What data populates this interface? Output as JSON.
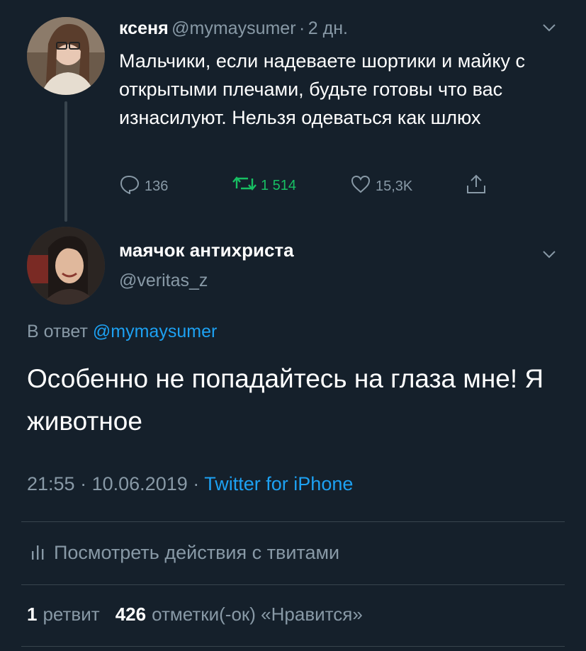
{
  "tweet1": {
    "name": "ксеня",
    "handle": "@mymaysumer",
    "separator": "·",
    "time": "2 дн.",
    "text": "Мальчики, если надеваете шортики и майку с открытыми плечами, будьте готовы что вас изнасилуют. Нельзя одеваться как шлюх",
    "replies": "136",
    "retweets": "1 514",
    "likes": "15,3K"
  },
  "tweet2": {
    "name": "маячок антихриста",
    "handle": "@veritas_z",
    "reply_prefix": "В ответ",
    "reply_to": "@mymaysumer",
    "text": "Особенно не попадайтесь на глаза мне! Я животное",
    "time": "21:55",
    "date": "10.06.2019",
    "separator": "·",
    "source": "Twitter for iPhone"
  },
  "activity": {
    "label": "Посмотреть действия с твитами"
  },
  "stats": {
    "retweets_count": "1",
    "retweets_label": "ретвит",
    "likes_count": "426",
    "likes_label": "отметки(-ок) «Нравится»"
  },
  "colors": {
    "background": "#15202b",
    "muted": "#8899a6",
    "accent": "#1da1f2",
    "retweet_active": "#17bf63"
  }
}
